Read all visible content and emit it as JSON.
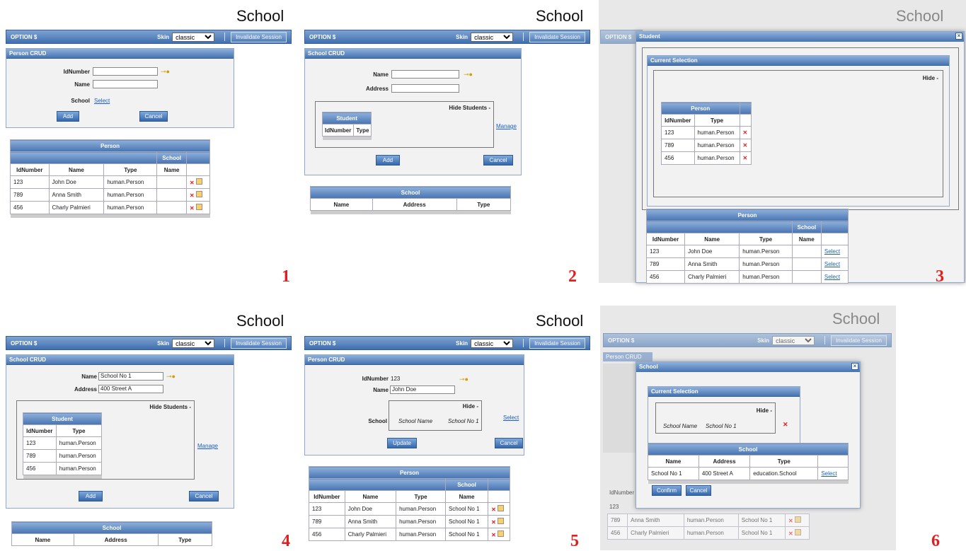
{
  "page_title": "School",
  "topbar": {
    "option": "OPTION $",
    "skin_label": "Skin",
    "skin_value": "classic",
    "invalidate": "Invalidate Session"
  },
  "labels": {
    "idnumber": "IdNumber",
    "name": "Name",
    "school": "School",
    "address": "Address",
    "type": "Type",
    "student": "Student",
    "person": "Person",
    "hide_students": "Hide Students -",
    "hide": "Hide -",
    "manage": "Manage",
    "select": "Select",
    "add": "Add",
    "cancel": "Cancel",
    "update": "Update",
    "confirm": "Confirm",
    "current_selection": "Current Selection",
    "person_crud": "Person CRUD",
    "school_crud": "School CRUD",
    "school_name": "School Name"
  },
  "persons": [
    {
      "id": "123",
      "name": "John Doe",
      "type": "human.Person",
      "school": "School No 1"
    },
    {
      "id": "789",
      "name": "Anna Smith",
      "type": "human.Person",
      "school": "School No 1"
    },
    {
      "id": "456",
      "name": "Charly Palmieri",
      "type": "human.Person",
      "school": "School No 1"
    }
  ],
  "school": {
    "name": "School No 1",
    "address": "400 Street A",
    "type": "education.School"
  },
  "panel_numbers": [
    "1",
    "2",
    "3",
    "4",
    "5",
    "6"
  ],
  "colors": {
    "accent": "#4674b2",
    "number": "#e02020"
  }
}
